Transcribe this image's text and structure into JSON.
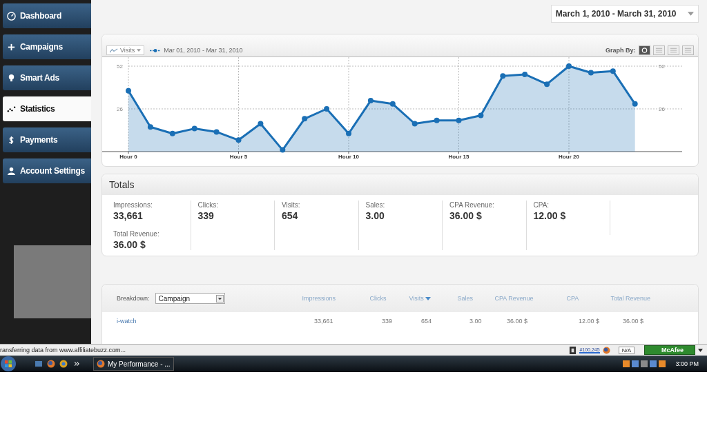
{
  "sidebar": {
    "items": [
      {
        "label": "Dashboard",
        "selected": false
      },
      {
        "label": "Campaigns",
        "selected": false
      },
      {
        "label": "Smart Ads",
        "selected": false
      },
      {
        "label": "Statistics",
        "selected": true
      },
      {
        "label": "Payments",
        "selected": false
      },
      {
        "label": "Account Settings",
        "selected": false
      }
    ]
  },
  "date_range": {
    "value": "March 1, 2010 - March 31, 2010"
  },
  "chart": {
    "metric_button": "Visits",
    "graph_by_label": "Graph By:",
    "graph_by_options": [
      {
        "selected": true
      },
      {
        "selected": false
      },
      {
        "selected": false
      },
      {
        "selected": false
      }
    ],
    "right_axis_labels": [
      "52",
      "26"
    ],
    "chart_data": {
      "type": "area",
      "categories": [
        "Hour 0",
        null,
        null,
        null,
        null,
        "Hour 5",
        null,
        null,
        null,
        null,
        "Hour 10",
        null,
        null,
        null,
        null,
        "Hour 15",
        null,
        null,
        null,
        null,
        "Hour 20",
        null,
        null,
        null
      ],
      "series": [
        {
          "name": "Mar 01, 2010 - Mar 31, 2010",
          "color": "#1a6fb5",
          "values": [
            37,
            15,
            11,
            14,
            12,
            7,
            17,
            1,
            20,
            26,
            11,
            31,
            29,
            17,
            19,
            19,
            22,
            46,
            47,
            41,
            52,
            48,
            49,
            29
          ]
        }
      ],
      "grid": true,
      "ylim": [
        0,
        52
      ],
      "yticks": [
        26,
        52
      ]
    }
  },
  "totals": {
    "title": "Totals",
    "metrics": [
      {
        "label": "Impressions:",
        "value": "33,661"
      },
      {
        "label": "Clicks:",
        "value": "339"
      },
      {
        "label": "Visits:",
        "value": "654"
      },
      {
        "label": "Sales:",
        "value": "3.00"
      },
      {
        "label": "CPA Revenue:",
        "value": "36.00 $"
      },
      {
        "label": "CPA:",
        "value": "12.00 $"
      },
      {
        "label": "Total Revenue:",
        "value": "36.00 $"
      }
    ]
  },
  "breakdown": {
    "label": "Breakdown:",
    "select": "Campaign",
    "columns": [
      {
        "label": "Impressions",
        "sorted": false
      },
      {
        "label": "Clicks",
        "sorted": false
      },
      {
        "label": "Visits",
        "sorted": true
      },
      {
        "label": "Sales",
        "sorted": false
      },
      {
        "label": "CPA Revenue",
        "sorted": false
      },
      {
        "label": "CPA",
        "sorted": false
      },
      {
        "label": "Total Revenue",
        "sorted": false
      }
    ],
    "rows": [
      {
        "name": "i-watch",
        "cells": [
          "33,661",
          "339",
          "654",
          "3.00",
          "36.00 $",
          "12.00 $",
          "36.00 $"
        ]
      }
    ]
  },
  "browser_status": {
    "text": "ransferring data from www.affiliatebuzz.com...",
    "rank": "#100,245",
    "na": "N/A",
    "security": "McAfee"
  },
  "taskbar": {
    "window": "My Performance - ...",
    "clock": "3:00 PM"
  }
}
